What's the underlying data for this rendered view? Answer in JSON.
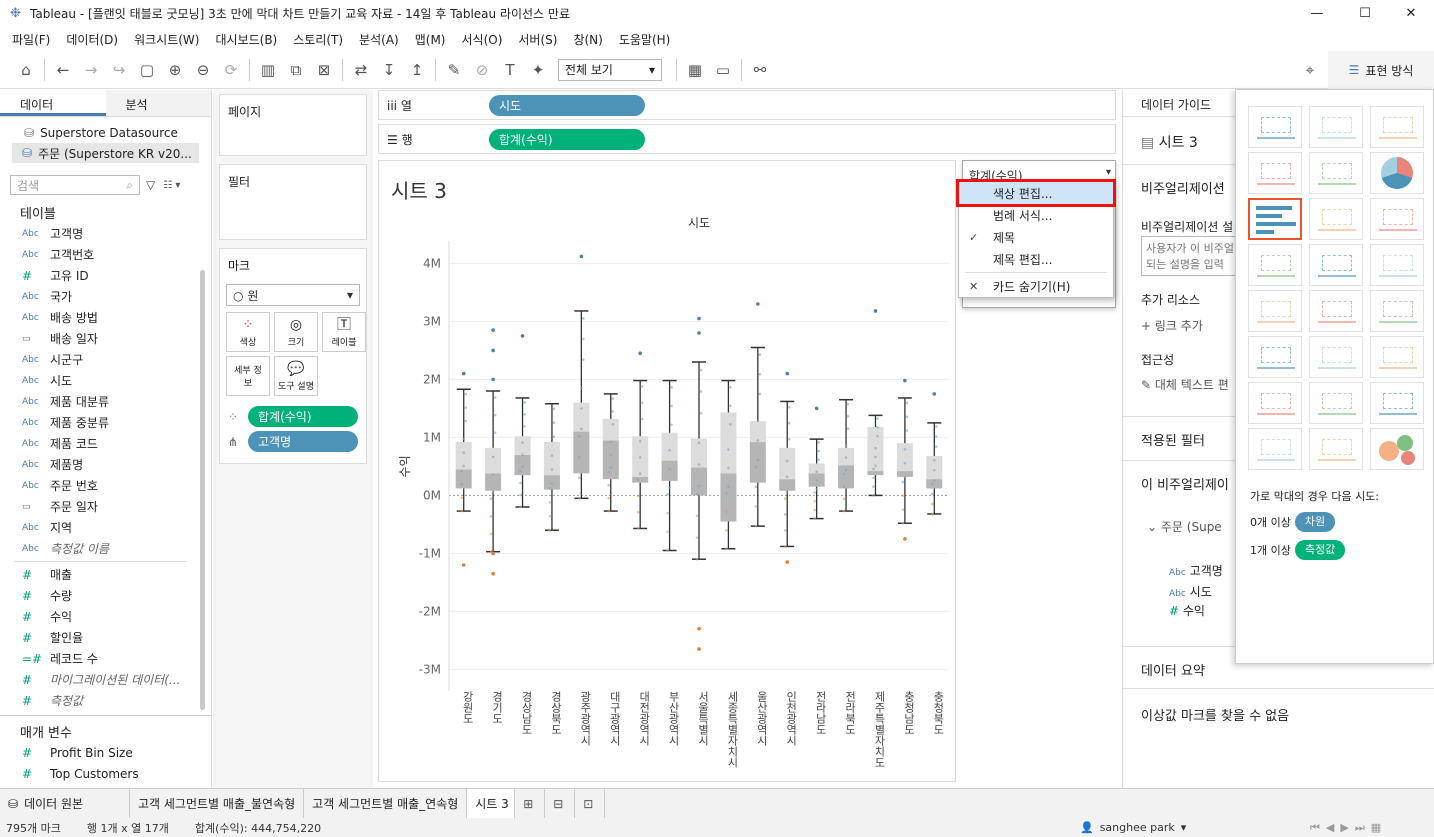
{
  "window": {
    "title": "Tableau - [플랜잇 태블로 굿모닝] 3초 만에 막대 차트 만들기 교육 자료 - 14일 후 Tableau 라이선스 만료",
    "minimize": "—",
    "maximize": "☐",
    "close": "✕"
  },
  "menu": [
    "파일(F)",
    "데이터(D)",
    "워크시트(W)",
    "대시보드(B)",
    "스토리(T)",
    "분석(A)",
    "맵(M)",
    "서식(O)",
    "서버(S)",
    "창(N)",
    "도움말(H)"
  ],
  "toolbar": {
    "view_select": "전체 보기",
    "showme_label": "표현 방식"
  },
  "left": {
    "tab_data": "데이터",
    "tab_analysis": "분석",
    "datasources": [
      "Superstore Datasource",
      "주문 (Superstore KR v20..."
    ],
    "search_placeholder": "검색",
    "tables_header": "테이블",
    "dimensions": [
      {
        "type": "Abc",
        "name": "고객명"
      },
      {
        "type": "Abc",
        "name": "고객번호"
      },
      {
        "type": "#",
        "name": "고유 ID"
      },
      {
        "type": "Abc",
        "name": "국가"
      },
      {
        "type": "Abc",
        "name": "배송 방법"
      },
      {
        "type": "▭",
        "name": "배송 일자"
      },
      {
        "type": "Abc",
        "name": "시군구"
      },
      {
        "type": "Abc",
        "name": "시도"
      },
      {
        "type": "Abc",
        "name": "제품 대분류"
      },
      {
        "type": "Abc",
        "name": "제품 중분류"
      },
      {
        "type": "Abc",
        "name": "제품 코드"
      },
      {
        "type": "Abc",
        "name": "제품명"
      },
      {
        "type": "Abc",
        "name": "주문 번호"
      },
      {
        "type": "▭",
        "name": "주문 일자"
      },
      {
        "type": "Abc",
        "name": "지역"
      },
      {
        "type": "Abc",
        "name": "측정값 이름"
      }
    ],
    "measures": [
      {
        "type": "#",
        "name": "매출"
      },
      {
        "type": "#",
        "name": "수량"
      },
      {
        "type": "#",
        "name": "수익"
      },
      {
        "type": "#",
        "name": "할인율"
      },
      {
        "type": "=#",
        "name": "레코드 수"
      },
      {
        "type": "#",
        "name": "마이그레이션된 데이터(..."
      },
      {
        "type": "#",
        "name": "측정값"
      }
    ],
    "params_header": "매개 변수",
    "params": [
      {
        "type": "#",
        "name": "Profit Bin Size"
      },
      {
        "type": "#",
        "name": "Top Customers"
      }
    ]
  },
  "shelves": {
    "pages": "페이지",
    "filters": "필터",
    "marks": "마크",
    "mark_type": "원",
    "mark_buttons": [
      "색상",
      "크기",
      "레이블",
      "세부 정보",
      "도구 설명"
    ],
    "mark_pills": [
      "합계(수익)",
      "고객명"
    ],
    "columns_label": "열",
    "columns_pill": "시도",
    "rows_label": "행",
    "rows_pill": "합계(수익)"
  },
  "sheet": {
    "title": "시트 3"
  },
  "legend": {
    "title": "합계(수익)"
  },
  "context_menu": {
    "items": [
      "색상 편집...",
      "범례 서식...",
      "제목",
      "제목 편집...",
      "카드 숨기기(H)"
    ]
  },
  "right": {
    "guide_title": "데이터 가이드",
    "sheet_name": "시트 3",
    "viz_section": "비주얼리제이션",
    "viz_desc_label": "비주얼리제이션 설",
    "desc_box": "사용자가 이 비주얼\n되는 설명을 입력",
    "extra_resources": "추가 리소스",
    "add_link": "링크 추가",
    "accessibility": "접근성",
    "alt_text": "대체 텍스트 편",
    "applied_filters": "적용된 필터",
    "this_viz": "이 비주얼리제이",
    "source": "주문 (Supe",
    "fields": [
      {
        "type": "Abc",
        "name": "고객명"
      },
      {
        "type": "Abc",
        "name": "시도"
      },
      {
        "type": "#",
        "name": "수익"
      }
    ],
    "data_summary": "데이터 요약",
    "outliers": "이상값 마크를 찾을 수 없음"
  },
  "showme": {
    "hint": "가로 막대의 경우 다음 시도:",
    "req1_prefix": "0개 이상",
    "req1_tag": "차원",
    "req2_prefix": "1개 이상",
    "req2_tag": "측정값"
  },
  "bottom_tabs": {
    "data_source": "데이터 원본",
    "sheets": [
      "고객 세그먼트별 매출_불연속형",
      "고객 세그먼트별 매출_연속형",
      "시트 3"
    ]
  },
  "status": {
    "marks": "795개 마크",
    "rows_cols": "행 1개 x 열 17개",
    "sum": "합계(수익): 444,754,220",
    "user": "sanghee park"
  },
  "chart_data": {
    "type": "box",
    "title": "",
    "header": "시도",
    "ylabel": "수익",
    "ylim": [
      -3.2,
      4.3
    ],
    "yticks": [
      "4M",
      "3M",
      "2M",
      "1M",
      "0M",
      "-1M",
      "-2M",
      "-3M"
    ],
    "ytick_values": [
      4,
      3,
      2,
      1,
      0,
      -1,
      -2,
      -3
    ],
    "categories": [
      "강원도",
      "경기도",
      "경상남도",
      "경상북도",
      "광주광역시",
      "대구광역시",
      "대전광역시",
      "부산광역시",
      "서울특별시",
      "세종특별자치시",
      "울산광역시",
      "인천광역시",
      "전라남도",
      "전라북도",
      "제주특별자치도",
      "충청남도",
      "충청북도"
    ],
    "boxes": [
      {
        "wmin": -0.27,
        "q1": 0.12,
        "med": 0.45,
        "q3": 0.92,
        "wmax": 1.83,
        "outliers": [
          2.1,
          -1.2
        ]
      },
      {
        "wmin": -0.97,
        "q1": 0.08,
        "med": 0.38,
        "q3": 0.82,
        "wmax": 1.8,
        "outliers": [
          2.5,
          2.85,
          2.0,
          -1.0,
          -1.35
        ]
      },
      {
        "wmin": -0.2,
        "q1": 0.35,
        "med": 0.7,
        "q3": 1.02,
        "wmax": 1.68,
        "outliers": [
          2.75
        ]
      },
      {
        "wmin": -0.6,
        "q1": 0.1,
        "med": 0.35,
        "q3": 0.92,
        "wmax": 1.58,
        "outliers": []
      },
      {
        "wmin": -0.05,
        "q1": 0.38,
        "med": 1.1,
        "q3": 1.6,
        "wmax": 3.18,
        "outliers": [
          4.12
        ]
      },
      {
        "wmin": -0.27,
        "q1": 0.28,
        "med": 0.95,
        "q3": 1.32,
        "wmax": 1.75,
        "outliers": []
      },
      {
        "wmin": -0.57,
        "q1": 0.22,
        "med": 0.32,
        "q3": 1.02,
        "wmax": 1.98,
        "outliers": [
          2.45
        ]
      },
      {
        "wmin": -0.95,
        "q1": 0.25,
        "med": 0.6,
        "q3": 1.08,
        "wmax": 1.98,
        "outliers": []
      },
      {
        "wmin": -1.1,
        "q1": 0.0,
        "med": 0.48,
        "q3": 0.98,
        "wmax": 2.3,
        "outliers": [
          3.05,
          2.8,
          -2.3,
          -2.65
        ]
      },
      {
        "wmin": -0.92,
        "q1": -0.45,
        "med": 0.38,
        "q3": 1.43,
        "wmax": 1.98,
        "outliers": []
      },
      {
        "wmin": -0.53,
        "q1": 0.22,
        "med": 0.92,
        "q3": 1.28,
        "wmax": 2.55,
        "outliers": [
          3.3
        ]
      },
      {
        "wmin": -0.88,
        "q1": 0.08,
        "med": 0.28,
        "q3": 0.82,
        "wmax": 1.62,
        "outliers": [
          2.1,
          -1.15
        ]
      },
      {
        "wmin": -0.4,
        "q1": 0.15,
        "med": 0.38,
        "q3": 0.55,
        "wmax": 0.97,
        "outliers": [
          1.5
        ]
      },
      {
        "wmin": -0.27,
        "q1": 0.12,
        "med": 0.52,
        "q3": 0.82,
        "wmax": 1.65,
        "outliers": []
      },
      {
        "wmin": 0.0,
        "q1": 0.35,
        "med": 0.42,
        "q3": 1.18,
        "wmax": 1.38,
        "outliers": [
          3.18
        ]
      },
      {
        "wmin": -0.48,
        "q1": 0.32,
        "med": 0.42,
        "q3": 0.9,
        "wmax": 1.68,
        "outliers": [
          1.98,
          -0.75
        ]
      },
      {
        "wmin": -0.32,
        "q1": 0.12,
        "med": 0.28,
        "q3": 0.68,
        "wmax": 1.25,
        "outliers": [
          1.75
        ]
      }
    ]
  }
}
